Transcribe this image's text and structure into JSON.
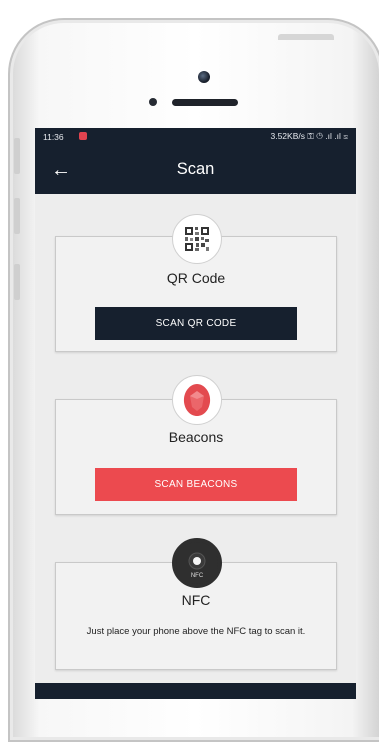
{
  "status_bar": {
    "time": "11:36",
    "right_text": "3.52KB/s ⚿ ◷ .ıl .ıl ≋"
  },
  "app_bar": {
    "back_icon": "arrow-left-icon",
    "title": "Scan"
  },
  "cards": [
    {
      "icon": "qr-code-icon",
      "title": "QR Code",
      "button_label": "SCAN QR CODE",
      "button_color": "#16202e"
    },
    {
      "icon": "beacon-icon",
      "title": "Beacons",
      "button_label": "SCAN BEACONS",
      "button_color": "#ec4a4f"
    },
    {
      "icon": "nfc-icon",
      "icon_text": "NFC",
      "title": "NFC",
      "description": "Just place your phone above the NFC tag to scan it."
    }
  ],
  "colors": {
    "primary_dark": "#16202e",
    "accent_red": "#ec4a4f"
  }
}
